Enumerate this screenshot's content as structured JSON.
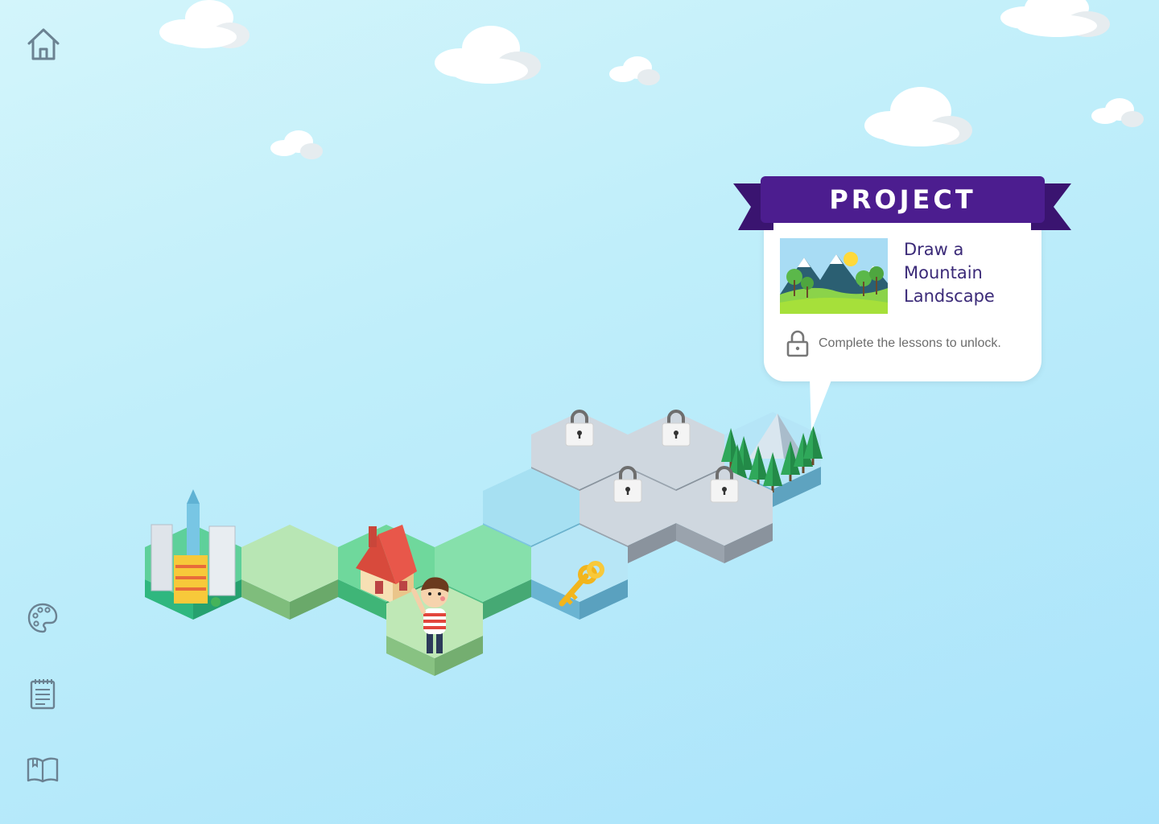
{
  "nav": {
    "home": "home-icon",
    "palette": "palette-icon",
    "notepad": "notepad-icon",
    "book": "book-icon"
  },
  "project": {
    "banner_label": "PROJECT",
    "title": "Draw a Mountain Landscape",
    "lock_message": "Complete the lessons to unlock.",
    "accent_color": "#4c1d8f"
  },
  "map": {
    "tiles": [
      {
        "id": "city",
        "state": "completed",
        "icon": "city-icon"
      },
      {
        "id": "meadow",
        "state": "completed",
        "icon": "none"
      },
      {
        "id": "house",
        "state": "completed",
        "icon": "house-icon"
      },
      {
        "id": "current",
        "state": "current",
        "icon": "player-character"
      },
      {
        "id": "path",
        "state": "completed",
        "icon": "none"
      },
      {
        "id": "key",
        "state": "available",
        "icon": "key-icon"
      },
      {
        "id": "water",
        "state": "available",
        "icon": "none"
      },
      {
        "id": "lock-1",
        "state": "locked",
        "icon": "lock-icon"
      },
      {
        "id": "lock-2",
        "state": "locked",
        "icon": "lock-icon"
      },
      {
        "id": "lock-3",
        "state": "locked",
        "icon": "lock-icon"
      },
      {
        "id": "lock-4",
        "state": "locked",
        "icon": "lock-icon"
      },
      {
        "id": "mountain",
        "state": "project",
        "icon": "mountain-icon"
      }
    ]
  }
}
